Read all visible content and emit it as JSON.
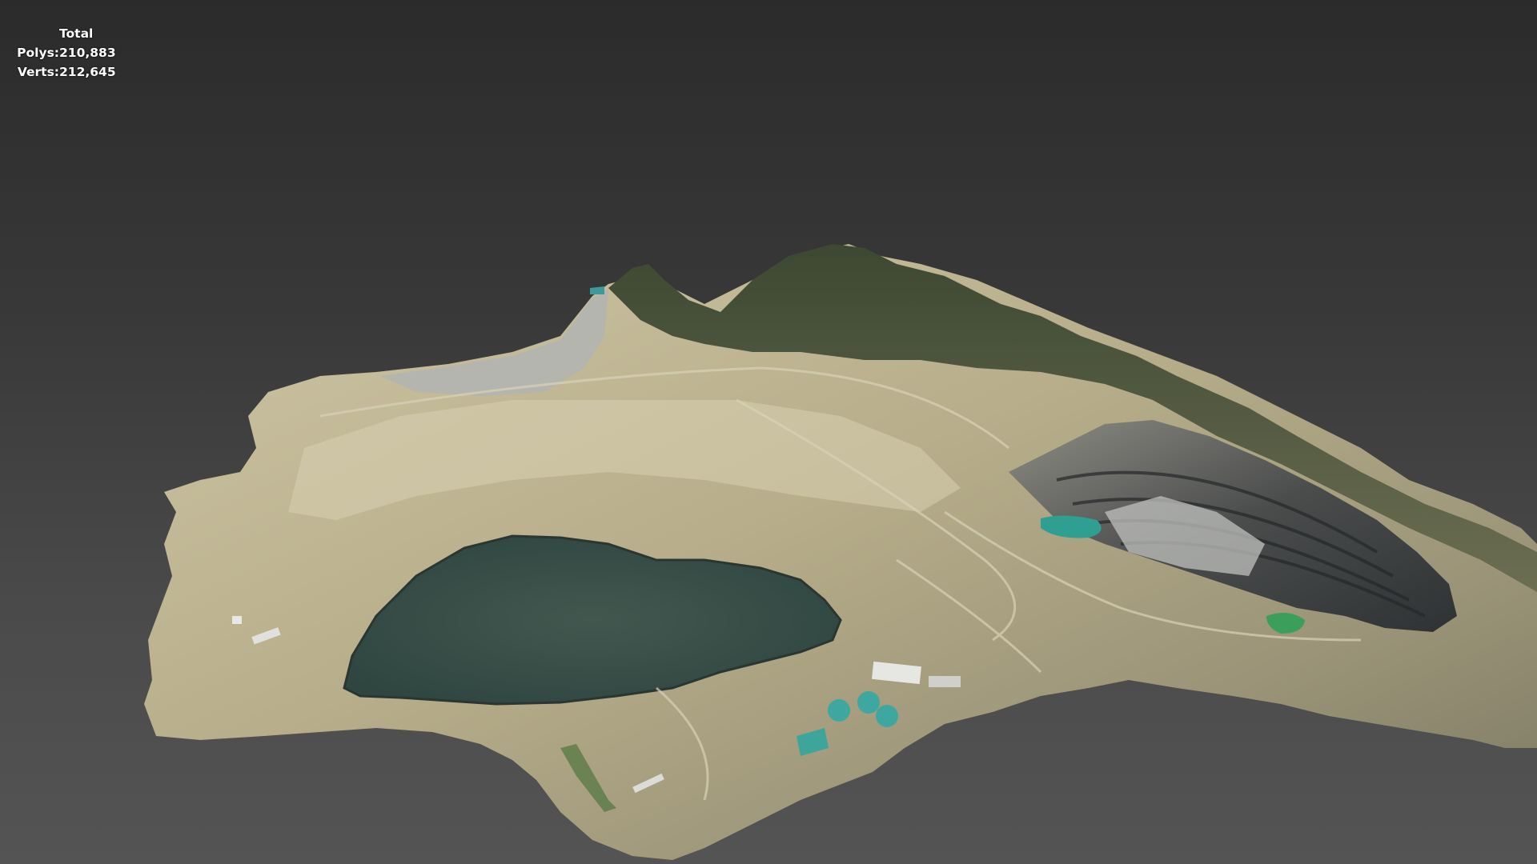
{
  "viewport": {
    "stats": {
      "header": "Total",
      "polys_label": "Polys:",
      "polys_value": "210,883",
      "verts_label": "Verts:",
      "verts_value": "212,645"
    }
  },
  "colors": {
    "background_top": "#2b2b2b",
    "background_bottom": "#545454",
    "terrain_light": "#c9bf9c",
    "terrain_dark": "#6f6a55",
    "pit_lake": "#3c524c",
    "vegetation": "#3d4a33",
    "pond": "#3aa89a"
  }
}
